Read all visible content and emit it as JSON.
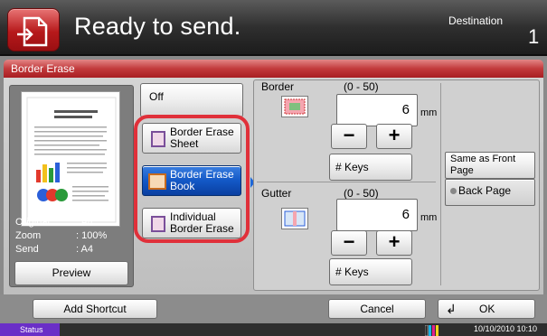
{
  "header": {
    "title": "Ready to send.",
    "destination_label": "Destination",
    "destination_count": "1",
    "icon": "send-document-icon"
  },
  "panel": {
    "title": "Border Erase",
    "preview": {
      "original_label": "Original",
      "original_value": ": A4",
      "zoom_label": "Zoom",
      "zoom_value": ": 100%",
      "send_label": "Send",
      "send_value": ": A4",
      "preview_button": "Preview"
    },
    "options": {
      "off": "Off",
      "sheet": "Border Erase Sheet",
      "book": "Border Erase Book",
      "individual": "Individual Border Erase",
      "selected": "book"
    },
    "border": {
      "title": "Border",
      "range": "(0 - 50)",
      "value": "6",
      "unit": "mm",
      "minus": "−",
      "plus": "+",
      "keys": "# Keys"
    },
    "gutter": {
      "title": "Gutter",
      "range": "(0 - 50)",
      "value": "6",
      "unit": "mm",
      "minus": "−",
      "plus": "+",
      "keys": "# Keys"
    },
    "side": {
      "same_front": "Same as Front Page",
      "back_page": "Back Page"
    }
  },
  "footer": {
    "add_shortcut": "Add Shortcut",
    "cancel": "Cancel",
    "ok": "OK",
    "ok_icon": "enter-arrow-icon"
  },
  "statusbar": {
    "status": "Status",
    "datetime": "10/10/2010  10:10"
  },
  "colors": {
    "accent_red": "#c23a3c",
    "selected_blue": "#1358c6",
    "status_purple": "#6a2fc7"
  }
}
